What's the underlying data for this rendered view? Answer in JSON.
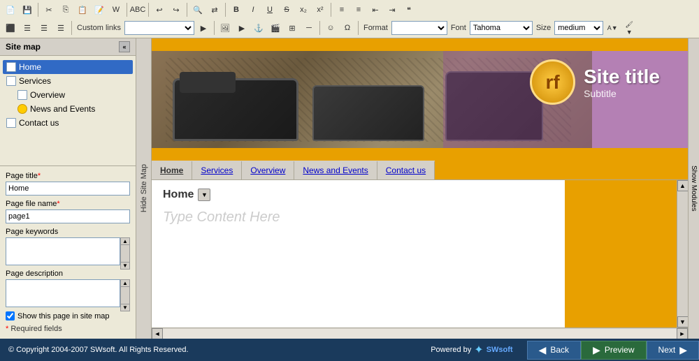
{
  "app": {
    "title": "Site map"
  },
  "toolbar": {
    "format_label": "Format",
    "font_label": "Font",
    "font_value": "Tahoma",
    "size_label": "Size",
    "size_value": "medium",
    "custom_links": "Custom links"
  },
  "sitemap": {
    "title": "Site map",
    "items": [
      {
        "id": "home",
        "label": "Home",
        "type": "page",
        "selected": true,
        "indent": 0
      },
      {
        "id": "services",
        "label": "Services",
        "type": "page",
        "selected": false,
        "indent": 0
      },
      {
        "id": "overview",
        "label": "Overview",
        "type": "page",
        "selected": false,
        "indent": 1
      },
      {
        "id": "news-events",
        "label": "News and Events",
        "type": "news",
        "selected": false,
        "indent": 1
      },
      {
        "id": "contact",
        "label": "Contact us",
        "type": "page",
        "selected": false,
        "indent": 0
      }
    ]
  },
  "page_props": {
    "title_label": "Page title",
    "title_required": true,
    "title_value": "Home",
    "filename_label": "Page file name",
    "filename_required": true,
    "filename_value": "page1",
    "keywords_label": "Page keywords",
    "description_label": "Page description",
    "show_sitemap_label": "Show this page in site map",
    "required_label": "Required fields"
  },
  "hide_panel": {
    "label": "Hide Site Map"
  },
  "site_header": {
    "logo_symbol": "rf",
    "site_title": "Site title",
    "subtitle": "Subtitle"
  },
  "nav": {
    "items": [
      {
        "id": "home",
        "label": "Home",
        "active": true
      },
      {
        "id": "services",
        "label": "Services",
        "active": false
      },
      {
        "id": "overview",
        "label": "Overview",
        "active": false
      },
      {
        "id": "news-events",
        "label": "News and Events",
        "active": false
      },
      {
        "id": "contact",
        "label": "Contact us",
        "active": false
      }
    ]
  },
  "content": {
    "page_title": "Home",
    "placeholder": "Type Content Here"
  },
  "footer": {
    "copyright": "© Copyright 2004-2007 SWsoft. All Rights Reserved.",
    "powered_by": "Powered by",
    "swsoft": "SWsoft",
    "back_label": "Back",
    "preview_label": "Preview",
    "next_label": "Next"
  },
  "show_modules_label": "Show Modules"
}
